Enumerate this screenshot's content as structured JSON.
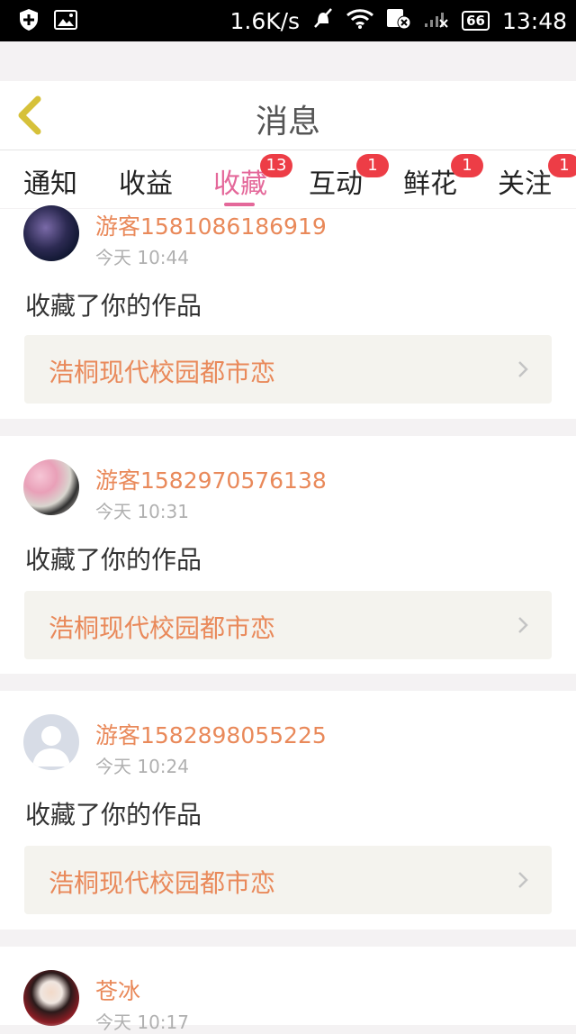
{
  "status_bar": {
    "speed": "1.6K/s",
    "battery": "66",
    "time": "13:48",
    "icons": [
      "shield-plus-icon",
      "image-icon",
      "mute-icon",
      "wifi-icon",
      "sim-icon",
      "signal-icon"
    ]
  },
  "header": {
    "title": "消息",
    "back_icon": "chevron-left-icon"
  },
  "tabs": [
    {
      "label": "通知",
      "badge": ""
    },
    {
      "label": "收益",
      "badge": ""
    },
    {
      "label": "收藏",
      "badge": "13",
      "active": true
    },
    {
      "label": "互动",
      "badge": "1"
    },
    {
      "label": "鲜花",
      "badge": "1"
    },
    {
      "label": "关注",
      "badge": "1"
    }
  ],
  "colors": {
    "accent": "#e4689a",
    "orange_text": "#e9895a",
    "badge": "#ed3d46"
  },
  "items": [
    {
      "user": "游客1581086186919",
      "time": "今天 10:44",
      "message": "收藏了你的作品",
      "work": "浩桐现代校园都市恋"
    },
    {
      "user": "游客1582970576138",
      "time": "今天 10:31",
      "message": "收藏了你的作品",
      "work": "浩桐现代校园都市恋"
    },
    {
      "user": "游客1582898055225",
      "time": "今天 10:24",
      "message": "收藏了你的作品",
      "work": "浩桐现代校园都市恋"
    },
    {
      "user": "苍冰",
      "time": "今天 10:17"
    }
  ]
}
